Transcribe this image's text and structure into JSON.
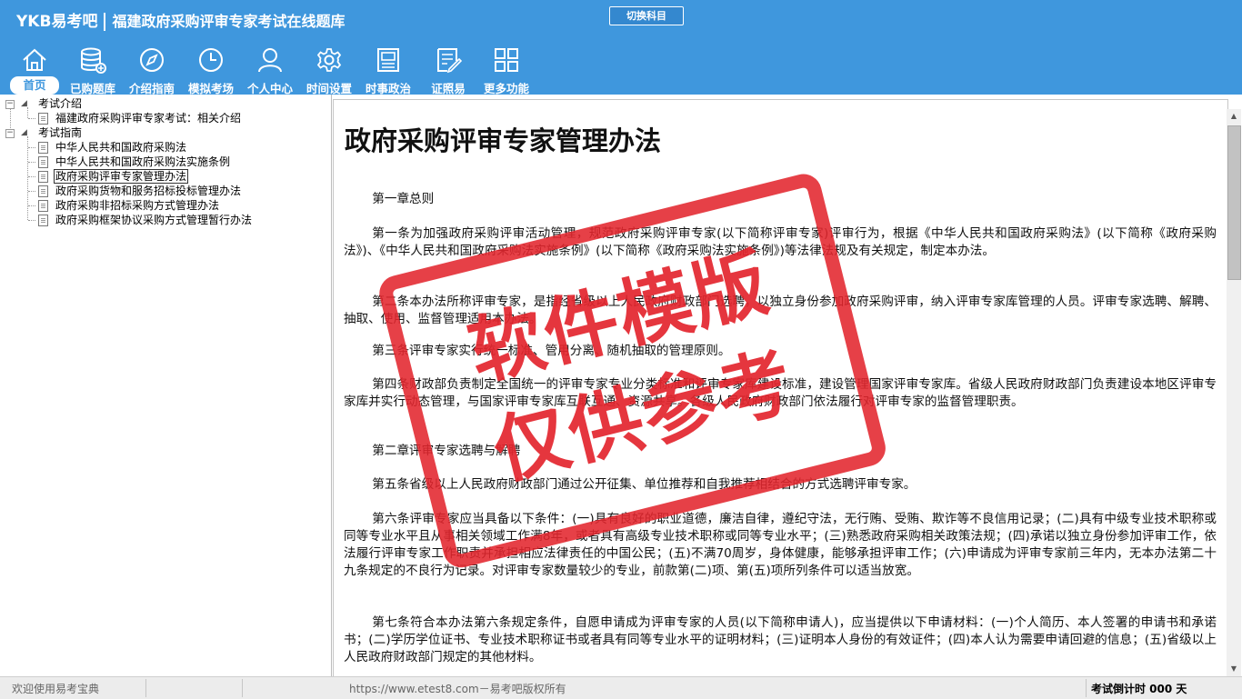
{
  "header": {
    "brand": "YKB易考吧",
    "app_title": "福建政府采购评审专家考试在线题库",
    "switch_button": "切换科目"
  },
  "nav": [
    {
      "label": "首页",
      "icon": "home-icon"
    },
    {
      "label": "已购题库",
      "icon": "database-icon"
    },
    {
      "label": "介绍指南",
      "icon": "compass-icon"
    },
    {
      "label": "模拟考场",
      "icon": "clock-icon"
    },
    {
      "label": "个人中心",
      "icon": "user-icon"
    },
    {
      "label": "时间设置",
      "icon": "gear-icon"
    },
    {
      "label": "时事政治",
      "icon": "news-icon"
    },
    {
      "label": "证照易",
      "icon": "certificate-icon"
    },
    {
      "label": "更多功能",
      "icon": "grid-icon"
    }
  ],
  "tree": {
    "group1": "考试介绍",
    "group1_items": [
      "福建政府采购评审专家考试：相关介绍"
    ],
    "group2": "考试指南",
    "group2_items": [
      "中华人民共和国政府采购法",
      "中华人民共和国政府采购法实施条例",
      "政府采购评审专家管理办法",
      "政府采购货物和服务招标投标管理办法",
      "政府采购非招标采购方式管理办法",
      "政府采购框架协议采购方式管理暂行办法"
    ]
  },
  "document": {
    "title": "政府采购评审专家管理办法",
    "paragraphs": [
      "第一章总则",
      "第一条为加强政府采购评审活动管理，规范政府采购评审专家(以下简称评审专家)评审行为，根据《中华人民共和国政府采购法》(以下简称《政府采购法》)、《中华人民共和国政府采购法实施条例》(以下简称《政府采购法实施条例》)等法律法规及有关规定，制定本办法。",
      "第二条本办法所称评审专家，是指经省级以上人民政府财政部门选聘，以独立身份参加政府采购评审，纳入评审专家库管理的人员。评审专家选聘、解聘、抽取、使用、监督管理适用本办法。",
      "第三条评审专家实行统一标准、管用分离、随机抽取的管理原则。",
      "第四条财政部负责制定全国统一的评审专家专业分类标准和评审专家库建设标准，建设管理国家评审专家库。省级人民政府财政部门负责建设本地区评审专家库并实行动态管理，与国家评审专家库互联互通、资源共享。各级人民政府财政部门依法履行对评审专家的监督管理职责。",
      "第二章评审专家选聘与解聘",
      "第五条省级以上人民政府财政部门通过公开征集、单位推荐和自我推荐相结合的方式选聘评审专家。",
      "第六条评审专家应当具备以下条件：(一)具有良好的职业道德，廉洁自律，遵纪守法，无行贿、受贿、欺诈等不良信用记录；(二)具有中级专业技术职称或同等专业水平且从事相关领域工作满8年，或者具有高级专业技术职称或同等专业水平；(三)熟悉政府采购相关政策法规；(四)承诺以独立身份参加评审工作，依法履行评审专家工作职责并承担相应法律责任的中国公民；(五)不满70周岁，身体健康，能够承担评审工作；(六)申请成为评审专家前三年内，无本办法第二十九条规定的不良行为记录。对评审专家数量较少的专业，前款第(二)项、第(五)项所列条件可以适当放宽。",
      "第七条符合本办法第六条规定条件，自愿申请成为评审专家的人员(以下简称申请人)，应当提供以下申请材料：(一)个人简历、本人签署的申请书和承诺书；(二)学历学位证书、专业技术职称证书或者具有同等专业水平的证明材料；(三)证明本人身份的有效证件；(四)本人认为需要申请回避的信息；(五)省级以上人民政府财政部门规定的其他材料。"
    ]
  },
  "watermark": {
    "line1": "软件模版",
    "line2": "仅供参考"
  },
  "status": {
    "welcome": "欢迎使用易考宝典",
    "url": "https://www.etest8.com－易考吧版权所有",
    "countdown": "考试倒计时 000 天"
  },
  "colors": {
    "header_bg": "#3f97dd",
    "watermark": "#e3262e"
  }
}
